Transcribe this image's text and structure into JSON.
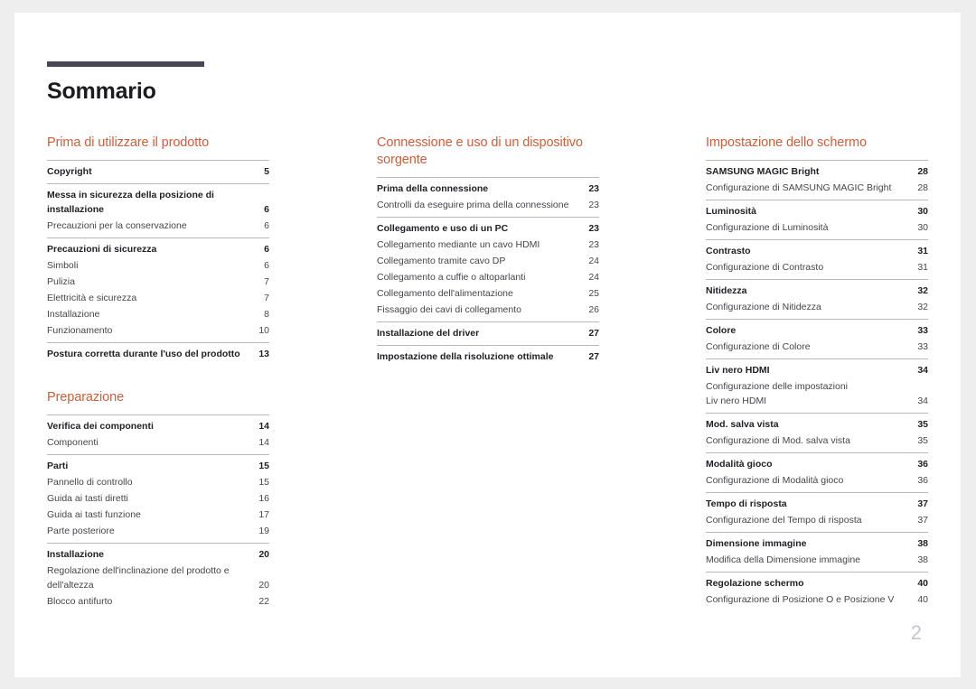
{
  "document": {
    "title": "Sommario",
    "folio": "2",
    "accent_color": "#cf5e3c",
    "rule_color": "#4a4655",
    "page_background": "#ffffff",
    "canvas_background": "#eeeeee"
  },
  "columns": [
    {
      "name": "column-1",
      "sections": [
        {
          "title": "Prima di utilizzare il prodotto",
          "groups": [
            {
              "entries": [
                {
                  "label": "Copyright",
                  "page": "5",
                  "level": "major"
                }
              ]
            },
            {
              "entries": [
                {
                  "label": "Messa in sicurezza della posizione di installazione",
                  "page": "6",
                  "level": "major",
                  "wrap_first": "Messa in sicurezza della posizione di",
                  "wrap_second": "installazione"
                },
                {
                  "label": "Precauzioni per la conservazione",
                  "page": "6",
                  "level": "minor"
                }
              ]
            },
            {
              "entries": [
                {
                  "label": "Precauzioni di sicurezza",
                  "page": "6",
                  "level": "major"
                },
                {
                  "label": "Simboli",
                  "page": "6",
                  "level": "minor"
                },
                {
                  "label": "Pulizia",
                  "page": "7",
                  "level": "minor"
                },
                {
                  "label": "Elettricità e sicurezza",
                  "page": "7",
                  "level": "minor"
                },
                {
                  "label": "Installazione",
                  "page": "8",
                  "level": "minor"
                },
                {
                  "label": "Funzionamento",
                  "page": "10",
                  "level": "minor"
                }
              ]
            },
            {
              "entries": [
                {
                  "label": "Postura corretta durante l'uso del prodotto",
                  "page": "13",
                  "level": "major"
                }
              ]
            }
          ]
        },
        {
          "title": "Preparazione",
          "groups": [
            {
              "entries": [
                {
                  "label": "Verifica dei componenti",
                  "page": "14",
                  "level": "major"
                },
                {
                  "label": "Componenti",
                  "page": "14",
                  "level": "minor"
                }
              ]
            },
            {
              "entries": [
                {
                  "label": "Parti",
                  "page": "15",
                  "level": "major"
                },
                {
                  "label": "Pannello di controllo",
                  "page": "15",
                  "level": "minor"
                },
                {
                  "label": "Guida ai tasti diretti",
                  "page": "16",
                  "level": "minor"
                },
                {
                  "label": "Guida ai tasti funzione",
                  "page": "17",
                  "level": "minor"
                },
                {
                  "label": "Parte posteriore",
                  "page": "19",
                  "level": "minor"
                }
              ]
            },
            {
              "entries": [
                {
                  "label": "Installazione",
                  "page": "20",
                  "level": "major"
                },
                {
                  "label": "Regolazione dell'inclinazione del prodotto e dell'altezza",
                  "page": "20",
                  "level": "minor",
                  "wrap_first": "Regolazione dell'inclinazione del prodotto e",
                  "wrap_second": "dell'altezza"
                },
                {
                  "label": "Blocco antifurto",
                  "page": "22",
                  "level": "minor"
                }
              ]
            }
          ]
        }
      ]
    },
    {
      "name": "column-2",
      "sections": [
        {
          "title": "Connessione e uso di un dispositivo sorgente",
          "title_line_1": "Connessione e uso di un dispositivo",
          "title_line_2": "sorgente",
          "groups": [
            {
              "entries": [
                {
                  "label": "Prima della connessione",
                  "page": "23",
                  "level": "major"
                },
                {
                  "label": "Controlli da eseguire prima della connessione",
                  "page": "23",
                  "level": "minor"
                }
              ]
            },
            {
              "entries": [
                {
                  "label": "Collegamento e uso di un PC",
                  "page": "23",
                  "level": "major"
                },
                {
                  "label": "Collegamento mediante un cavo HDMI",
                  "page": "23",
                  "level": "minor"
                },
                {
                  "label": "Collegamento tramite cavo DP",
                  "page": "24",
                  "level": "minor"
                },
                {
                  "label": "Collegamento a cuffie o altoparlanti",
                  "page": "24",
                  "level": "minor"
                },
                {
                  "label": "Collegamento dell'alimentazione",
                  "page": "25",
                  "level": "minor"
                },
                {
                  "label": "Fissaggio dei cavi di collegamento",
                  "page": "26",
                  "level": "minor"
                }
              ]
            },
            {
              "entries": [
                {
                  "label": "Installazione del driver",
                  "page": "27",
                  "level": "major"
                }
              ]
            },
            {
              "entries": [
                {
                  "label": "Impostazione della risoluzione ottimale",
                  "page": "27",
                  "level": "major"
                }
              ]
            }
          ]
        }
      ]
    },
    {
      "name": "column-3",
      "sections": [
        {
          "title": "Impostazione dello schermo",
          "groups": [
            {
              "entries": [
                {
                  "label": "SAMSUNG MAGIC Bright",
                  "page": "28",
                  "level": "major"
                },
                {
                  "label": "Configurazione di SAMSUNG MAGIC Bright",
                  "page": "28",
                  "level": "minor"
                }
              ]
            },
            {
              "entries": [
                {
                  "label": "Luminosità",
                  "page": "30",
                  "level": "major"
                },
                {
                  "label": "Configurazione di Luminosità",
                  "page": "30",
                  "level": "minor"
                }
              ]
            },
            {
              "entries": [
                {
                  "label": "Contrasto",
                  "page": "31",
                  "level": "major"
                },
                {
                  "label": "Configurazione di Contrasto",
                  "page": "31",
                  "level": "minor"
                }
              ]
            },
            {
              "entries": [
                {
                  "label": "Nitidezza",
                  "page": "32",
                  "level": "major"
                },
                {
                  "label": "Configurazione di Nitidezza",
                  "page": "32",
                  "level": "minor"
                }
              ]
            },
            {
              "entries": [
                {
                  "label": "Colore",
                  "page": "33",
                  "level": "major"
                },
                {
                  "label": "Configurazione di Colore",
                  "page": "33",
                  "level": "minor"
                }
              ]
            },
            {
              "entries": [
                {
                  "label": "Liv nero HDMI",
                  "page": "34",
                  "level": "major"
                },
                {
                  "label": "Configurazione delle impostazioni Liv nero HDMI",
                  "page": "34",
                  "level": "minor",
                  "wrap_first": "Configurazione delle impostazioni",
                  "wrap_second": "Liv nero HDMI"
                }
              ]
            },
            {
              "entries": [
                {
                  "label": "Mod. salva vista",
                  "page": "35",
                  "level": "major"
                },
                {
                  "label": "Configurazione di Mod. salva vista",
                  "page": "35",
                  "level": "minor"
                }
              ]
            },
            {
              "entries": [
                {
                  "label": "Modalità gioco",
                  "page": "36",
                  "level": "major"
                },
                {
                  "label": "Configurazione di Modalità gioco",
                  "page": "36",
                  "level": "minor"
                }
              ]
            },
            {
              "entries": [
                {
                  "label": "Tempo di risposta",
                  "page": "37",
                  "level": "major"
                },
                {
                  "label": "Configurazione del Tempo di risposta",
                  "page": "37",
                  "level": "minor"
                }
              ]
            },
            {
              "entries": [
                {
                  "label": "Dimensione immagine",
                  "page": "38",
                  "level": "major"
                },
                {
                  "label": "Modifica della Dimensione immagine",
                  "page": "38",
                  "level": "minor"
                }
              ]
            },
            {
              "entries": [
                {
                  "label": "Regolazione schermo",
                  "page": "40",
                  "level": "major"
                },
                {
                  "label": "Configurazione di Posizione O e Posizione V",
                  "page": "40",
                  "level": "minor"
                }
              ]
            }
          ]
        }
      ]
    }
  ]
}
